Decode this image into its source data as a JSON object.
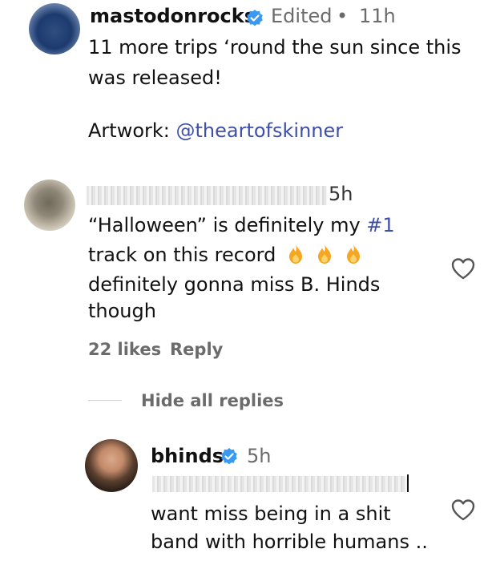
{
  "comment1": {
    "username": "mastodonrocks",
    "edited": "Edited",
    "dot": "•",
    "time": "11h",
    "text_line1": "11 more trips ‘round the sun since this",
    "text_line2": "was released!",
    "artwork_label": "Artwork: ",
    "artwork_mention": "@theartofskinner"
  },
  "comment2": {
    "time": "5h",
    "line1_prefix": "“Halloween” is definitely my ",
    "line1_hashtag": "#1",
    "line2": "track on this record",
    "line3": "definitely gonna miss B. Hinds",
    "line4": "though",
    "likes": "22 likes",
    "reply": "Reply",
    "hide_replies": "Hide all replies"
  },
  "comment3": {
    "username": "bhinds",
    "time": "5h",
    "line1": "want miss being in a shit",
    "line2": "band with horrible humans .."
  },
  "colors": {
    "link": "#3f4fa8",
    "verified": "#3a9af2",
    "fire": "#f5a623",
    "meta": "#6b6b6b"
  }
}
